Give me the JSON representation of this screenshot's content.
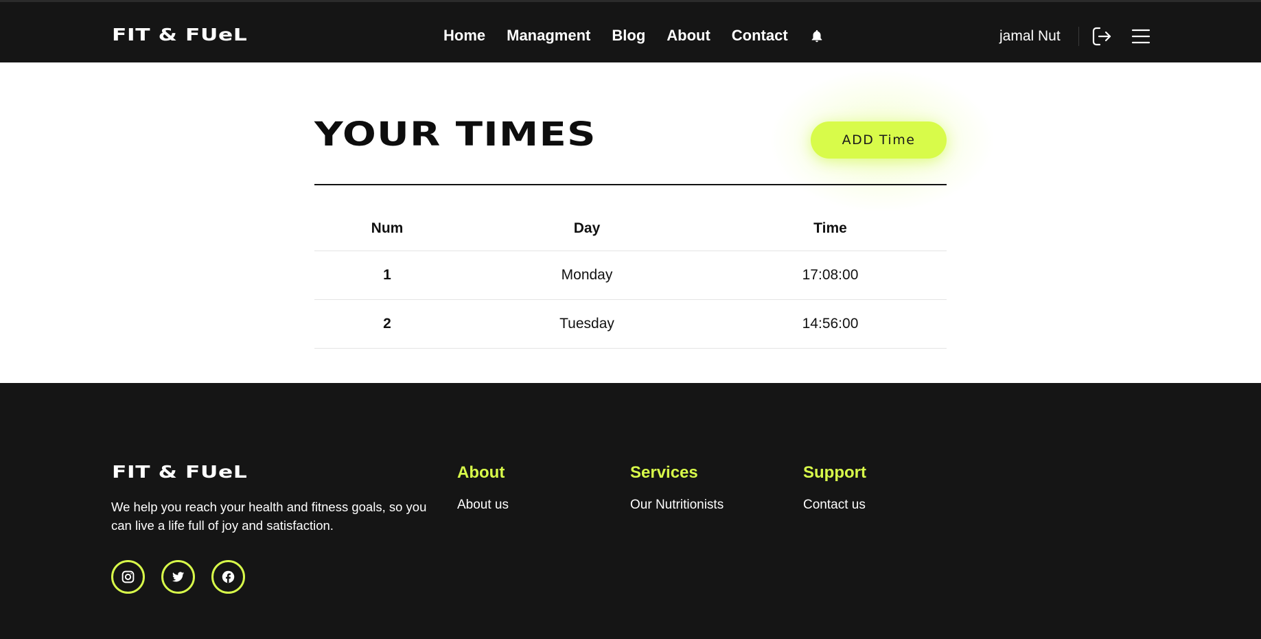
{
  "brand": {
    "logo": "FIT & FUeL"
  },
  "nav": {
    "links": [
      "Home",
      "Managment",
      "Blog",
      "About",
      "Contact"
    ],
    "user_name": "jamal Nut"
  },
  "main": {
    "title": "YOUR TIMES",
    "add_button": "ADD Time",
    "table": {
      "headers": [
        "Num",
        "Day",
        "Time"
      ],
      "rows": [
        [
          "1",
          "Monday",
          "17:08:00"
        ],
        [
          "2",
          "Tuesday",
          "14:56:00"
        ]
      ]
    }
  },
  "footer": {
    "logo": "FIT & FUeL",
    "description": "We help you reach your health and fitness goals, so you can live a life full of joy and satisfaction.",
    "columns": [
      {
        "title": "About",
        "link": "About us"
      },
      {
        "title": "Services",
        "link": "Our Nutritionists"
      },
      {
        "title": "Support",
        "link": "Contact us"
      }
    ],
    "socials": [
      "instagram-icon",
      "twitter-icon",
      "facebook-icon"
    ]
  },
  "colors": {
    "accent": "#d8fb4a",
    "dark": "#151515",
    "text": "#111111"
  }
}
